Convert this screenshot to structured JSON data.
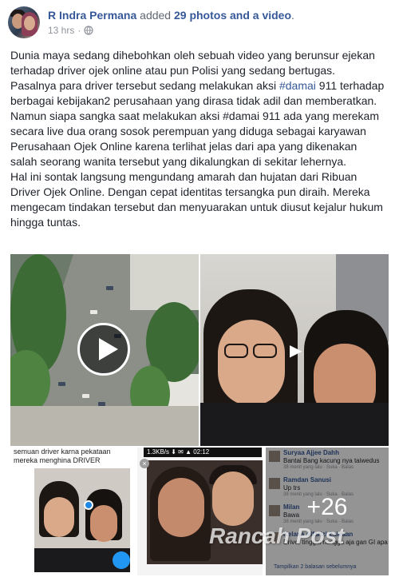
{
  "post": {
    "author": "R Indra Permana",
    "action_prefix": "added",
    "action_count": "29 photos and a video",
    "action_suffix": ".",
    "timestamp": "13 hrs",
    "separator": "·",
    "privacy_icon": "globe-icon"
  },
  "body": {
    "p1": "Dunia maya sedang dihebohkan oleh sebuah video yang berunsur ejekan terhadap driver ojek online atau pun Polisi yang sedang bertugas.",
    "p2_before": "Pasalnya para driver tersebut sedang melakukan aksi ",
    "p2_tag": "#damai",
    "p2_after": " 911 terhadap berbagai kebijakan2 perusahaan yang dirasa tidak adil dan memberatkan.",
    "p3": "Namun siapa sangka saat melakukan aksi #damai 911 ada yang merekam secara live dua orang sosok perempuan yang diduga sebagai karyawan Perusahaan Ojek Online karena terlihat jelas dari apa yang dikenakan salah seorang wanita tersebut yang dikalungkan di sekitar lehernya.",
    "p4": "Hal ini sontak langsung mengundang amarah dan hujatan dari Ribuan Driver Ojek Online. Dengan cepat identitas tersangka pun diraih. Mereka mengecam tindakan tersebut dan menyuarakan untuk diusut kejalur hukum hingga tuntas."
  },
  "media": {
    "photo3_caption": "semuan driver karna pekataan mereka menghina DRIVER",
    "photo4_status": "1.3KB/s ⬇ ✉ ▲ 02:12",
    "photo4_close": "×",
    "more_count": "+26",
    "comments": [
      {
        "name": "Suryaa Ajjee Dahh",
        "text": "Bantai Bang kacung nya taiwedus",
        "meta": "38 menit yang lalu · Suka · Balas"
      },
      {
        "name": "Ramdan Sanusi",
        "text": "Up trs",
        "meta": "38 menit yang lalu · Suka · Balas"
      },
      {
        "name": "Milan",
        "text": "Bawa",
        "meta": "38 menit yang lalu · Suka · Balas"
      },
      {
        "name": "Kelana Alfarizi Zaidaan",
        "text": "Driver tinggal nunggu aja gan GI apa",
        "meta": ""
      }
    ],
    "comments_footer": "Tampilkan 2 balasan sebelumnya",
    "watermark": "Rancah Post"
  }
}
